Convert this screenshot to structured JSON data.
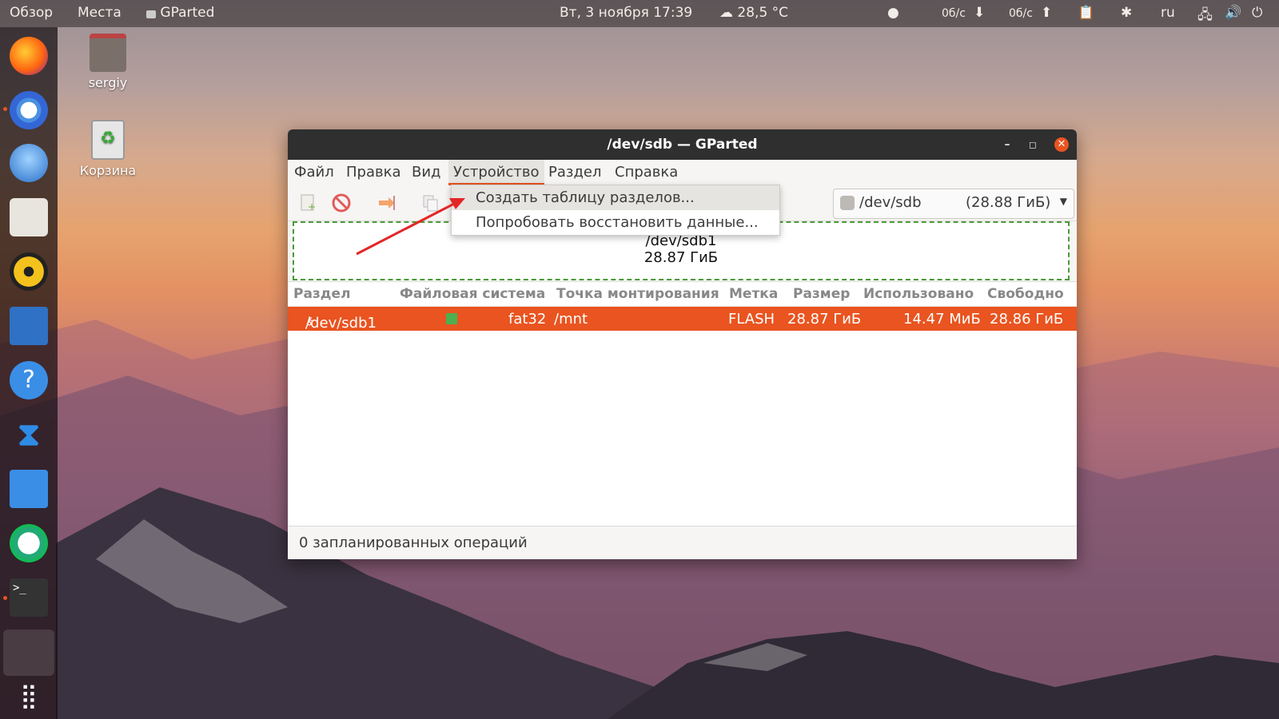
{
  "topbar": {
    "overview": "Обзор",
    "places": "Места",
    "app_name": "GParted",
    "datetime": "Вт, 3 ноября  17:39",
    "weather": "28,5 °C",
    "net_down": "0б/с",
    "net_up": "0б/с",
    "lang": "ru"
  },
  "desktop": {
    "home_label": "sergiy",
    "trash_label": "Корзина"
  },
  "window": {
    "title": "/dev/sdb — GParted",
    "menu": {
      "file": "Файл",
      "edit": "Правка",
      "view": "Вид",
      "device": "Устройство",
      "partition": "Раздел",
      "help": "Справка"
    },
    "device_selector": {
      "device": "/dev/sdb",
      "size": "(28.88 ГиБ)"
    },
    "graph": {
      "name": "/dev/sdb1",
      "size": "28.87 ГиБ"
    },
    "columns": {
      "partition": "Раздел",
      "fs": "Файловая система",
      "mount": "Точка монтирования",
      "label": "Метка",
      "size": "Размер",
      "used": "Использовано",
      "free": "Свободно"
    },
    "rows": [
      {
        "partition": "/dev/sdb1",
        "fs": "fat32",
        "mount": "/mnt",
        "label": "FLASH",
        "size": "28.87 ГиБ",
        "used": "14.47 МиБ",
        "free": "28.86 ГиБ"
      }
    ],
    "status": "0 запланированных операций",
    "device_menu": {
      "create_table": "Создать таблицу разделов...",
      "recover": "Попробовать восстановить данные..."
    }
  },
  "colors": {
    "accent": "#e95420",
    "fs_fat32": "#4caf50"
  }
}
